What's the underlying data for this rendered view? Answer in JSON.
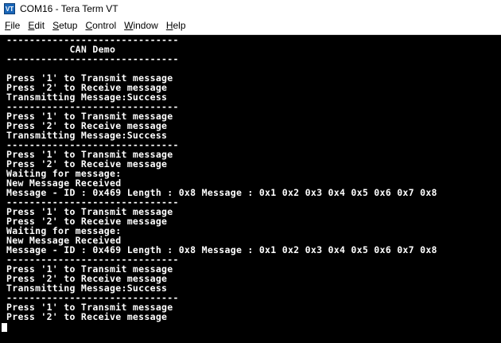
{
  "window": {
    "title": "COM16 - Tera Term VT",
    "icon": "VT"
  },
  "menu": [
    {
      "label": "File",
      "key": "F",
      "rest": "ile"
    },
    {
      "label": "Edit",
      "key": "E",
      "rest": "dit"
    },
    {
      "label": "Setup",
      "key": "S",
      "rest": "etup"
    },
    {
      "label": "Control",
      "key": "C",
      "rest": "ontrol"
    },
    {
      "label": "Window",
      "key": "W",
      "rest": "indow"
    },
    {
      "label": "Help",
      "key": "H",
      "rest": "elp"
    }
  ],
  "terminal": {
    "lines": [
      "------------------------------",
      "           CAN Demo           ",
      "------------------------------",
      "",
      "Press '1' to Transmit message",
      "Press '2' to Receive message",
      "Transmitting Message:Success",
      "------------------------------",
      "Press '1' to Transmit message",
      "Press '2' to Receive message",
      "Transmitting Message:Success",
      "------------------------------",
      "Press '1' to Transmit message",
      "Press '2' to Receive message",
      "Waiting for message:",
      "New Message Received",
      "Message - ID : 0x469 Length : 0x8 Message : 0x1 0x2 0x3 0x4 0x5 0x6 0x7 0x8",
      "------------------------------",
      "Press '1' to Transmit message",
      "Press '2' to Receive message",
      "Waiting for message:",
      "New Message Received",
      "Message - ID : 0x469 Length : 0x8 Message : 0x1 0x2 0x3 0x4 0x5 0x6 0x7 0x8",
      "------------------------------",
      "Press '1' to Transmit message",
      "Press '2' to Receive message",
      "Transmitting Message:Success",
      "------------------------------",
      "Press '1' to Transmit message",
      "Press '2' to Receive message"
    ]
  }
}
